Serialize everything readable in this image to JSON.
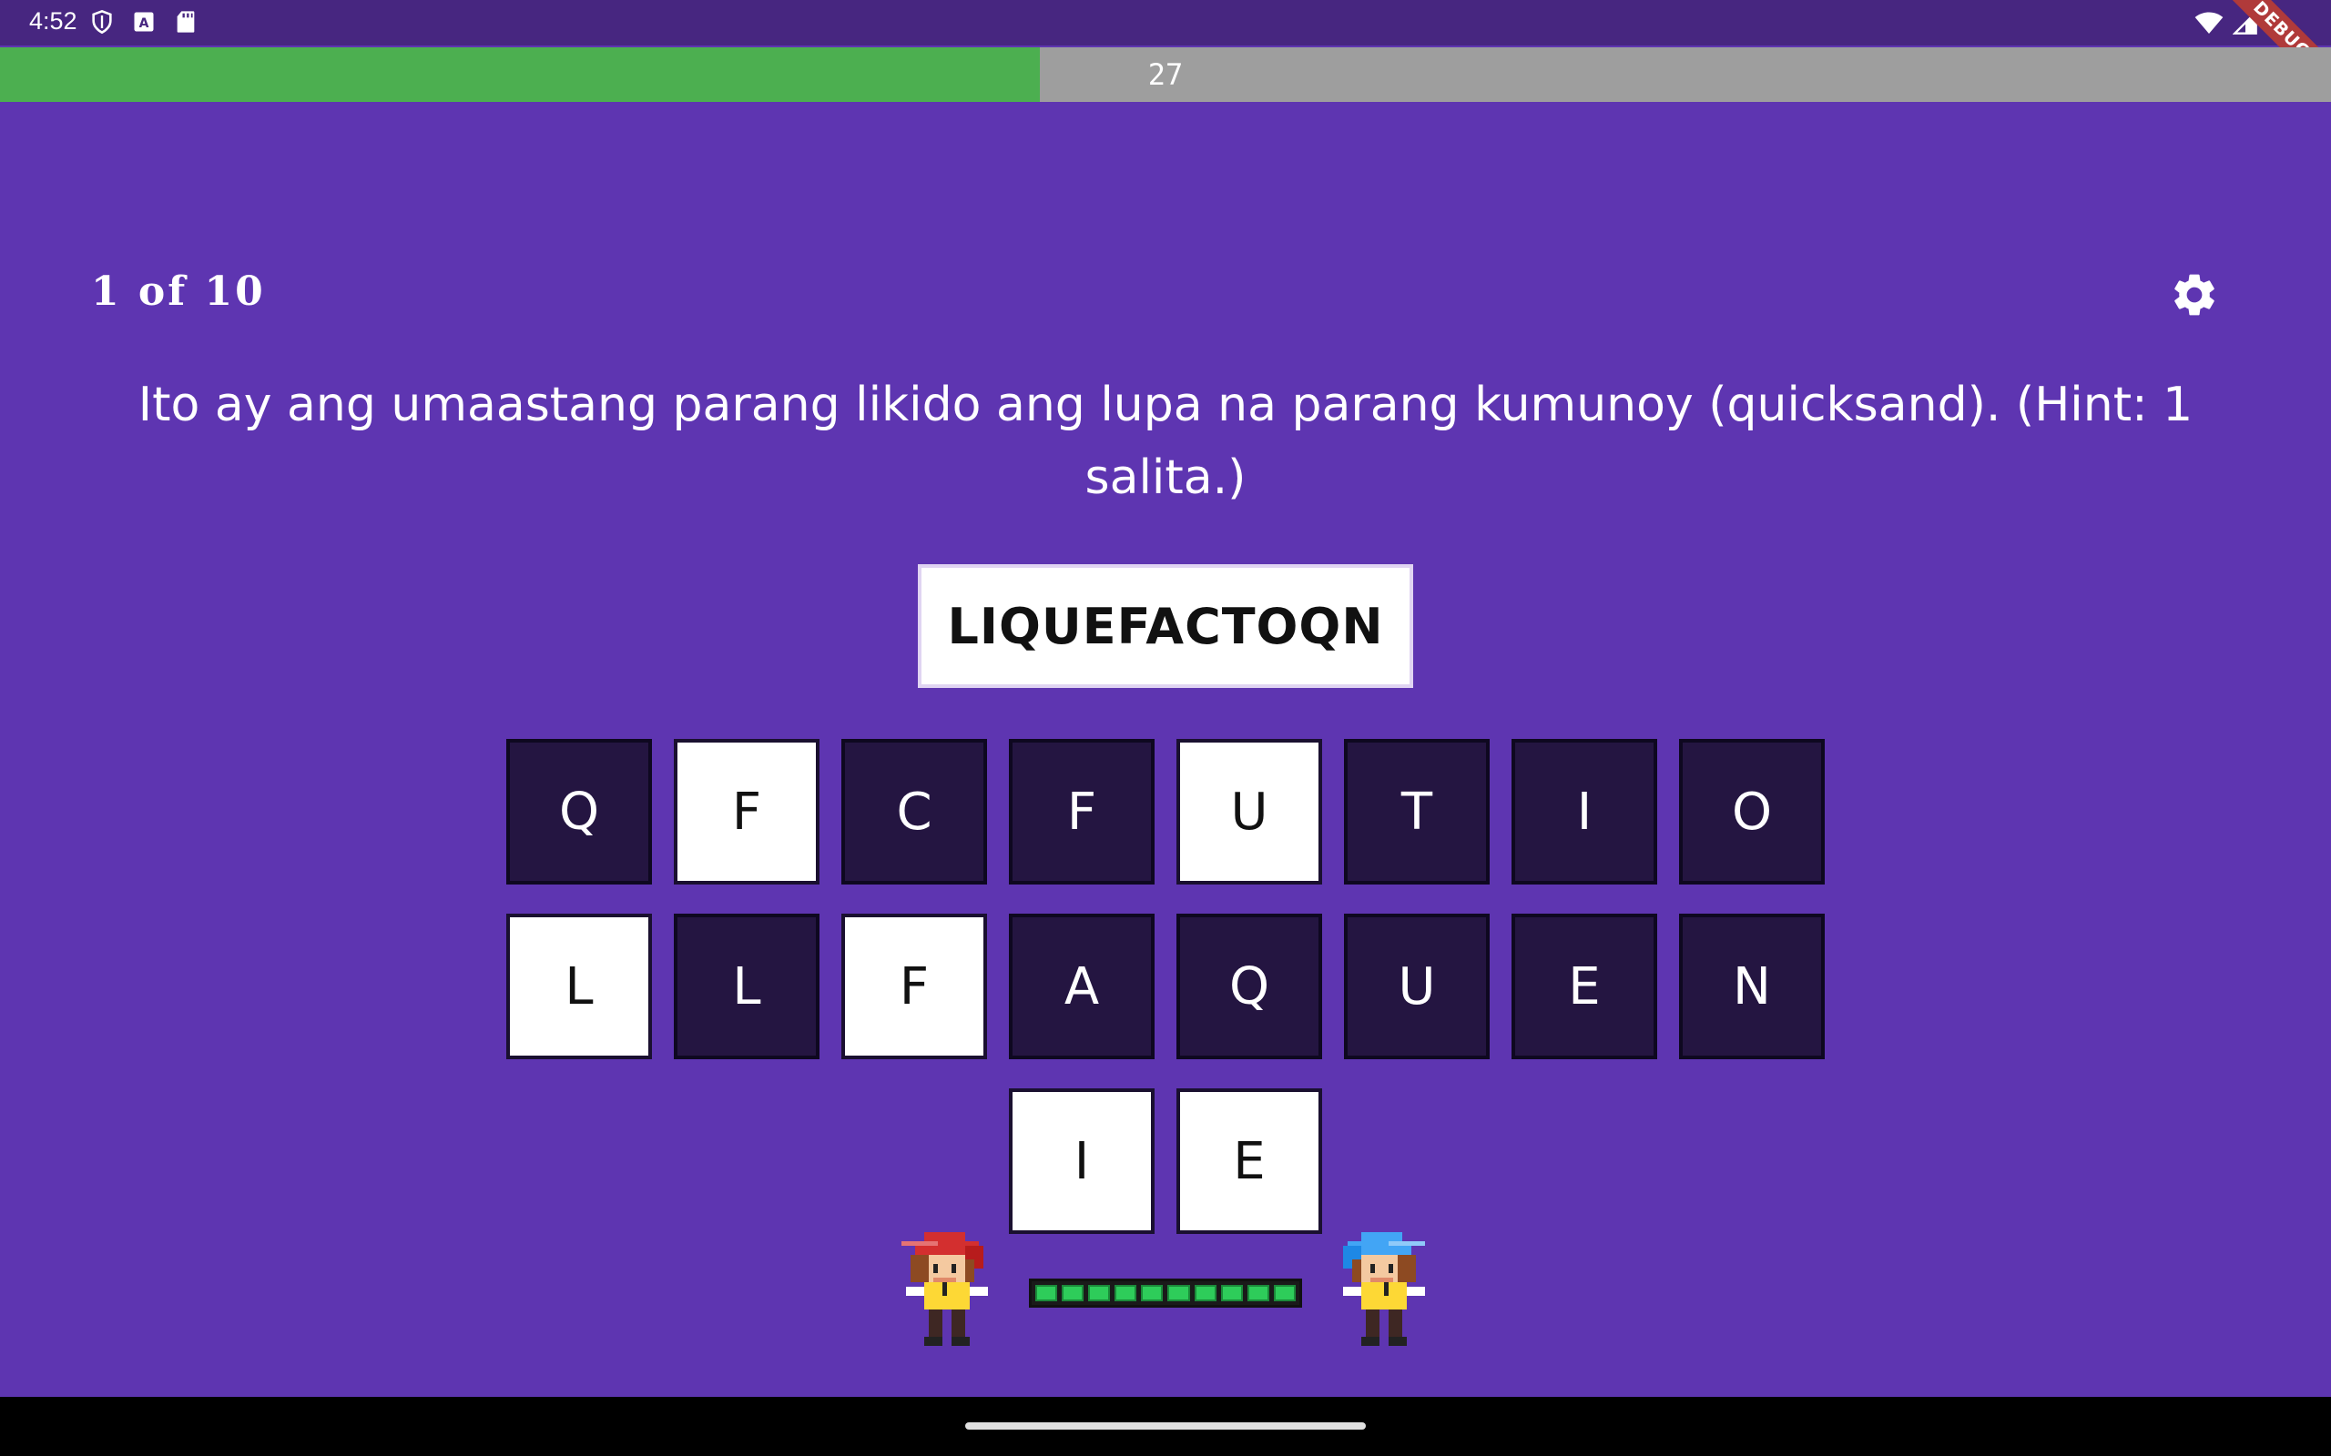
{
  "status_bar": {
    "time": "4:52",
    "left_icons": [
      "shield-icon",
      "a-icon",
      "sd-card-icon"
    ],
    "right_icons": [
      "wifi-icon",
      "signal-icon",
      "battery-icon"
    ]
  },
  "debug_banner": "DEBUG",
  "timer": {
    "value": "27",
    "fraction": 0.446,
    "fill_color": "#4caf50",
    "track_color": "#9e9e9e"
  },
  "progress": {
    "label": "1 of 10"
  },
  "settings": {
    "icon": "gear-icon"
  },
  "question": {
    "text": "Ito ay ang umaastang parang likido ang lupa na parang kumunoy (quicksand). (Hint: 1 salita.)"
  },
  "answer": {
    "text": "LIQUEFACTOQN"
  },
  "tiles": {
    "row1": [
      {
        "letter": "Q",
        "state": "dark"
      },
      {
        "letter": "F",
        "state": "light"
      },
      {
        "letter": "C",
        "state": "dark"
      },
      {
        "letter": "F",
        "state": "dark"
      },
      {
        "letter": "U",
        "state": "light"
      },
      {
        "letter": "T",
        "state": "dark"
      },
      {
        "letter": "I",
        "state": "dark"
      },
      {
        "letter": "O",
        "state": "dark"
      }
    ],
    "row2": [
      {
        "letter": "L",
        "state": "light"
      },
      {
        "letter": "L",
        "state": "dark"
      },
      {
        "letter": "F",
        "state": "light"
      },
      {
        "letter": "A",
        "state": "dark"
      },
      {
        "letter": "Q",
        "state": "dark"
      },
      {
        "letter": "U",
        "state": "dark"
      },
      {
        "letter": "E",
        "state": "dark"
      },
      {
        "letter": "N",
        "state": "dark"
      }
    ],
    "row3": [
      {
        "letter": "I",
        "state": "light"
      },
      {
        "letter": "E",
        "state": "light"
      }
    ]
  },
  "characters": {
    "player": "red-haired-character",
    "opponent": "blue-haired-character"
  },
  "health": {
    "segments_filled": 10,
    "segments_total": 10,
    "color": "#2ecc5a"
  },
  "colors": {
    "background": "#5e35b1",
    "status_bar": "#472680",
    "tile_dark": "#241541",
    "tile_light": "#ffffff"
  }
}
